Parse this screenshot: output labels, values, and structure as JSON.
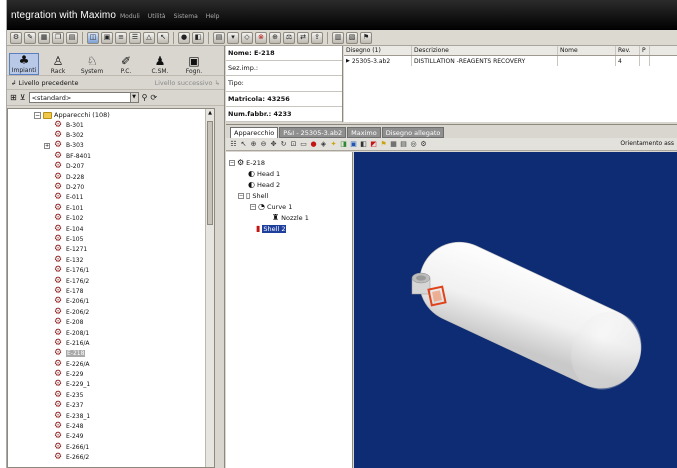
{
  "titlebar": {
    "title": "ntegration with Maximo",
    "menus": [
      "Moduli",
      "Utilità",
      "Sistema",
      "Help"
    ]
  },
  "left_tools": [
    {
      "label": "Impianti",
      "icon": "plant-icon",
      "active": true
    },
    {
      "label": "Rack",
      "icon": "rack-icon"
    },
    {
      "label": "System",
      "icon": "system-icon"
    },
    {
      "label": "P.C.",
      "icon": "pc-icon"
    },
    {
      "label": "C.SM.",
      "icon": "csm-icon"
    },
    {
      "label": "Fogn.",
      "icon": "sewer-icon"
    }
  ],
  "level": {
    "previous": "Livello precedente",
    "next": "Livello successivo"
  },
  "filter": {
    "value": "<standard>"
  },
  "tree": {
    "root_label": "Apparecchi",
    "root_count": "(108)",
    "selected": "E-218",
    "items": [
      "B-301",
      "B-302",
      "B-303",
      "BF-8401",
      "D-207",
      "D-228",
      "D-270",
      "E-011",
      "E-101",
      "E-102",
      "E-104",
      "E-105",
      "E-1271",
      "E-132",
      "E-176/1",
      "E-176/2",
      "E-178",
      "E-206/1",
      "E-206/2",
      "E-208",
      "E-208/1",
      "E-216/A",
      "E-218",
      "E-226/A",
      "E-229",
      "E-229_1",
      "E-235",
      "E-237",
      "E-238_1",
      "E-248",
      "E-249",
      "E-266/1",
      "E-266/2"
    ]
  },
  "properties": {
    "nome": "Nome: E-218",
    "sez": "Sez.imp.:",
    "tipo": "Tipo:",
    "matricola": "Matricola: 43256",
    "num_fabbr": "Num.fabbr.: 4233"
  },
  "drawings": {
    "headers": [
      "Disegno (1)",
      "Descrizione",
      "Nome",
      "Rev.",
      "P"
    ],
    "rows": [
      [
        "25305-3.ab2",
        "DISTILLATION -REAGENTS RECOVERY",
        "",
        "4",
        ""
      ]
    ]
  },
  "tabs": [
    "Apparecchio",
    "P&I - 25305-3.ab2",
    "Maximo",
    "Disegno allegato"
  ],
  "viewer": {
    "orientation_label": "Orientamento ass"
  },
  "component_tree": {
    "root": "E-218",
    "items": [
      "Head 1",
      "Head 2",
      "Shell",
      "Curve 1",
      "Nozzle 1",
      "Shell 2"
    ]
  },
  "colors": {
    "viewport_bg": "#0e2c73",
    "vessel": "#f4f4f4",
    "highlight": "#e0431a",
    "selection": "#1f3f9c"
  }
}
